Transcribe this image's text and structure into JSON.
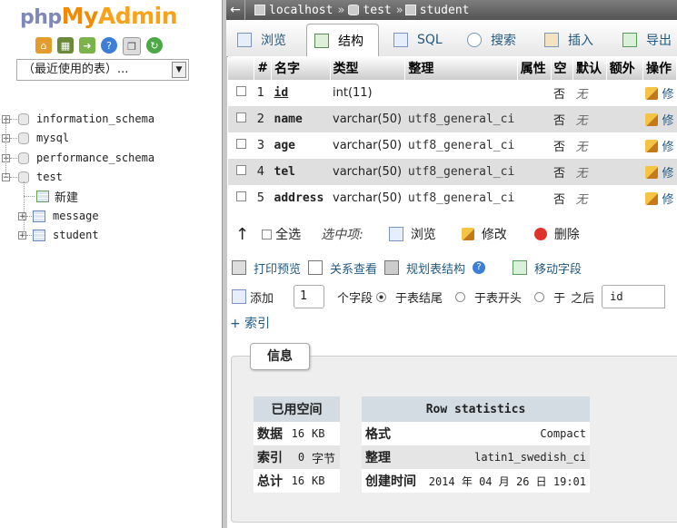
{
  "logo": {
    "php": "php",
    "my": "My",
    "admin": "Admin"
  },
  "nav_icons": [
    "home-icon",
    "database-icon",
    "exit-icon",
    "help-icon",
    "copy-icon",
    "refresh-icon"
  ],
  "recent_select": {
    "value": "（最近使用的表）..."
  },
  "tree": {
    "databases": [
      "information_schema",
      "mysql",
      "performance_schema",
      "test"
    ],
    "new_label": "新建",
    "tables": [
      "message",
      "student"
    ]
  },
  "breadcrumb": {
    "server": "localhost",
    "db": "test",
    "table": "student",
    "sep": "»"
  },
  "tabs": [
    {
      "label": "浏览",
      "icon": "browse-icon"
    },
    {
      "label": "结构",
      "icon": "structure-icon"
    },
    {
      "label": "SQL",
      "icon": "sql-icon"
    },
    {
      "label": "搜索",
      "icon": "search-icon"
    },
    {
      "label": "插入",
      "icon": "insert-icon"
    },
    {
      "label": "导出",
      "icon": "export-icon"
    }
  ],
  "columns": {
    "num": "#",
    "name": "名字",
    "type": "类型",
    "collation": "整理",
    "attributes": "属性",
    "null": "空",
    "default": "默认",
    "extra": "额外",
    "action": "操作"
  },
  "rows": [
    {
      "num": "1",
      "name": "id",
      "type": "int(11)",
      "collation": "",
      "null": "否",
      "default": "无",
      "action": "修"
    },
    {
      "num": "2",
      "name": "name",
      "type": "varchar(50)",
      "collation": "utf8_general_ci",
      "null": "否",
      "default": "无",
      "action": "修"
    },
    {
      "num": "3",
      "name": "age",
      "type": "varchar(50)",
      "collation": "utf8_general_ci",
      "null": "否",
      "default": "无",
      "action": "修"
    },
    {
      "num": "4",
      "name": "tel",
      "type": "varchar(50)",
      "collation": "utf8_general_ci",
      "null": "否",
      "default": "无",
      "action": "修"
    },
    {
      "num": "5",
      "name": "address",
      "type": "varchar(50)",
      "collation": "utf8_general_ci",
      "null": "否",
      "default": "无",
      "action": "修"
    }
  ],
  "selection": {
    "check_all": "全选",
    "with_selected": "选中项:",
    "browse": "浏览",
    "change": "修改",
    "drop": "删除"
  },
  "tools": {
    "print": "打印预览",
    "relation": "关系查看",
    "propose": "规划表结构",
    "move": "移动字段"
  },
  "add": {
    "label": "添加",
    "count": "1",
    "fields": "个字段",
    "at_end": "于表结尾",
    "at_begin": "于表开头",
    "after": "于",
    "after2": "之后",
    "after_field": "id"
  },
  "index_link": "+ 索引",
  "info": {
    "legend": "信息",
    "space": {
      "title": "已用空间",
      "rows": [
        [
          "数据",
          "16",
          "KB"
        ],
        [
          "索引",
          "0",
          "字节"
        ],
        [
          "总计",
          "16",
          "KB"
        ]
      ]
    },
    "stats": {
      "title": "Row statistics",
      "rows": [
        [
          "格式",
          "Compact"
        ],
        [
          "整理",
          "latin1_swedish_ci"
        ],
        [
          "创建时间",
          "2014 年 04 月 26 日 19:01"
        ]
      ]
    }
  }
}
